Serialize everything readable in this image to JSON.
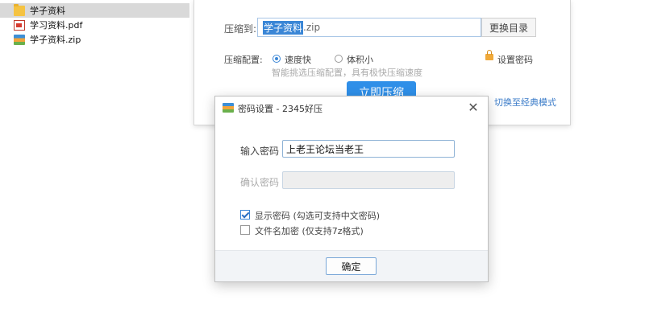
{
  "explorer": {
    "files": [
      {
        "name": "学子资料",
        "icon": "folder-icon",
        "selected": true
      },
      {
        "name": "学习资料.pdf",
        "icon": "pdf-file-icon",
        "selected": false
      },
      {
        "name": "学子资料.zip",
        "icon": "zip-archive-icon",
        "selected": false
      }
    ]
  },
  "compress_window": {
    "target_label": "压缩到:",
    "target_name_selected": "学子资料",
    "target_ext": ".zip",
    "browse_button": "更换目录",
    "config_label": "压缩配置:",
    "option_fast": "速度快",
    "option_small": "体积小",
    "selected_option": "速度快",
    "hint": "智能挑选压缩配置，具有极快压缩速度",
    "set_password": "设置密码",
    "start_button": "立即压缩",
    "classic_mode_link": "切换至经典模式"
  },
  "password_dialog": {
    "title": "密码设置 - 2345好压",
    "password_label": "输入密码",
    "password_value": "上老王论坛当老王",
    "confirm_label": "确认密码",
    "confirm_value": "",
    "show_password_label": "显示密码 (勾选可支持中文密码)",
    "show_password_checked": true,
    "encrypt_filenames_label": "文件名加密  (仅支持7z格式)",
    "encrypt_filenames_checked": false,
    "ok_button": "确定"
  },
  "colors": {
    "accent": "#2f8fe8",
    "selection": "#3a86d6",
    "link": "#3a7bc8"
  }
}
